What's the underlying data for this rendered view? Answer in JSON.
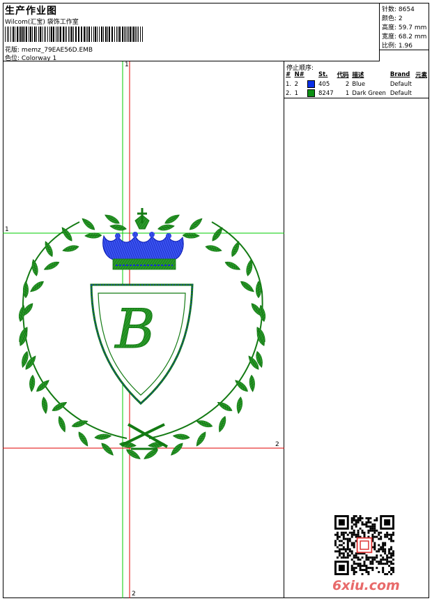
{
  "header": {
    "title": "生产作业图",
    "company": "Wilcom(汇宝) 袋饰工作室",
    "design_label": "花版:",
    "design_name": "memz_79EAE56D.EMB",
    "colorway_label": "色位:",
    "colorway_name": "Colorway 1"
  },
  "stats": [
    {
      "label": "针数:",
      "value": "8654"
    },
    {
      "label": "颜色:",
      "value": "2"
    },
    {
      "label": "高度:",
      "value": "59.7 mm"
    },
    {
      "label": "宽度:",
      "value": "68.2 mm"
    },
    {
      "label": "比例:",
      "value": "1.96"
    }
  ],
  "stops": {
    "title": "停止顺序:",
    "headers": [
      "#",
      "N#",
      "St.",
      "代码",
      "描述",
      "Brand",
      "元素"
    ],
    "rows": [
      {
        "num": "1.",
        "n": "2",
        "swatch": "#0a2fe6",
        "st": "405",
        "code": "2",
        "desc": "Blue",
        "brand": "Default",
        "elem": ""
      },
      {
        "num": "2.",
        "n": "1",
        "swatch": "#0b8f12",
        "st": "8247",
        "code": "1",
        "desc": "Dark Green",
        "brand": "Default",
        "elem": ""
      }
    ]
  },
  "guides": {
    "top_marker": "1",
    "left_marker": "1",
    "right_marker": "2",
    "bottom_marker": "2"
  },
  "colors": {
    "green": "#1e8a1e",
    "blue": "#1428e0",
    "guide_green": "#00cc00",
    "guide_red": "#e00000"
  },
  "watermark": "6xiu.com"
}
